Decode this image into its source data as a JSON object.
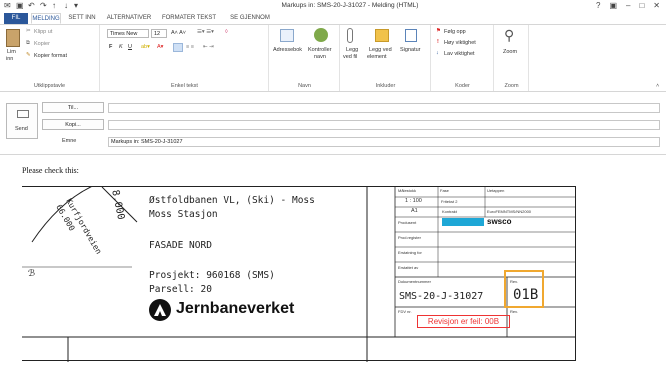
{
  "window": {
    "title": "Markups in: SMS-20-J-31027 - Melding (HTML)",
    "controls": [
      "?",
      "▣",
      "–",
      "□",
      "✕"
    ]
  },
  "tabs": [
    "FIL",
    "MELDING",
    "SETT INN",
    "ALTERNATIVER",
    "FORMATER TEKST",
    "SE GJENNOM"
  ],
  "ribbon": {
    "clipboard": {
      "paste": "Lim",
      "paste2": "inn",
      "cut": "Klipp ut",
      "copy": "Kopier",
      "format_painter": "Kopier format",
      "label": "Utklippstavle"
    },
    "basic_text": {
      "font": "Times New",
      "size": "12",
      "label": "Enkel tekst"
    },
    "names": {
      "address_book": "Adressebok",
      "check_names": "Kontroller",
      "check_names2": "navn",
      "label": "Navn"
    },
    "include": {
      "attach_file": "Legg",
      "attach_file2": "ved fil",
      "attach_item": "Legg ved",
      "attach_item2": "element",
      "signature": "Signatur",
      "label": "Inkluder"
    },
    "tags": {
      "follow_up": "Følg opp",
      "high": "Høy viktighet",
      "low": "Lav viktighet",
      "label": "Koder"
    },
    "zoom": {
      "zoom": "Zoom",
      "label": "Zoom"
    }
  },
  "compose": {
    "send": "Send",
    "to": "Til...",
    "cc": "Kopi...",
    "subject_label": "Emne",
    "subject_value": "Markups in: SMS-20-J-31027"
  },
  "message": {
    "text": "Please check this:"
  },
  "drawing": {
    "dim_value": "8.000",
    "road_name": "Kurfjordveien",
    "road_value": "66.000",
    "line1": "Østfoldbanen VL, (Ski) - Moss",
    "line2": "Moss Stasjon",
    "line3": "FASADE NORD",
    "project": "Prosjekt: 960168 (SMS)",
    "parcel": "Parsell: 20",
    "logo": "Jernbaneverket",
    "left_mark": "ℬ",
    "scale_label": "Målestokk",
    "scale_value": "1 : 100",
    "format_value": "A1",
    "phase_label": "Fase",
    "phase_value": "Fritekst 2",
    "unused_label": "Uetappen",
    "ref_label": "Kontrakt",
    "ref_value": "EuroFEMNTMS/NN2000",
    "producer": "Produsent",
    "company": "swsco",
    "prod_reg": "Prod.register",
    "replaces": "Erstatning for",
    "replaced_by": "Erstattet av",
    "doc_number_label": "Dokumentnummer",
    "doc_number": "SMS-20-J-31027",
    "rev_label": "Rev.",
    "rev": "01B",
    "fdv": "FDV nr.",
    "revision_note": "Revisjon er feil: 00B"
  }
}
